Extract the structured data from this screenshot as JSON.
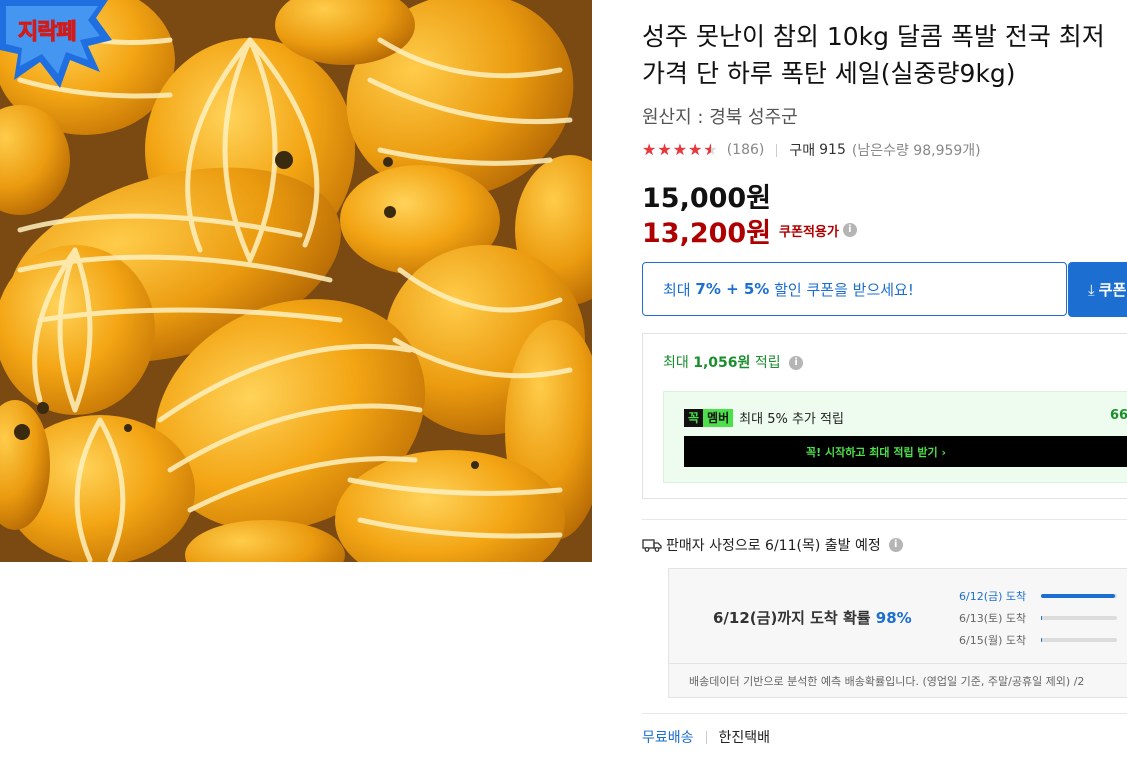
{
  "image": {
    "alt": "성주 참외",
    "badge_text": "지락페"
  },
  "product": {
    "title_line1": "성주 못난이 참외 10kg 달콤 폭발 전국 최저",
    "title_line2": "가격 단 하루 폭탄 세일(실중량9kg)",
    "origin_label": "원산지 :",
    "origin_value": "경북 성주군",
    "rating_fraction": 0.9,
    "review_count": "(186)",
    "purchase_label": "구매",
    "purchase_count": "915",
    "stock_text": "(남은수량 98,959개)"
  },
  "price": {
    "original": "15,000원",
    "sale": "13,200원",
    "coupon_note": "쿠폰적용가"
  },
  "coupon": {
    "prefix": "최대",
    "discount": "7% + 5%",
    "suffix": "할인 쿠폰을 받으세요!",
    "button_label": "쿠폰"
  },
  "reward": {
    "prefix": "최대",
    "amount": "1,056원",
    "suffix": "적립",
    "badge_dark": "꼭",
    "badge_green": "멤버",
    "member_text": "최대 5% 추가 적립",
    "member_amount": "66",
    "cta": "꼭! 시작하고 최대 적립 받기 ›"
  },
  "shipping": {
    "notice": "판매자 사정으로 6/11(목) 출발 예정",
    "arrival_prefix": "6/12(금)까지 도착 확률",
    "arrival_pct": "98%",
    "days": [
      {
        "date": "6/12(금) 도착",
        "fraction": 0.98
      },
      {
        "date": "6/13(토) 도착",
        "fraction": 0.01
      },
      {
        "date": "6/15(월) 도착",
        "fraction": 0.01
      }
    ],
    "footnote": "배송데이터 기반으로 분석한 예측 배송확률입니다. (영업일 기준, 주말/공휴일 제외) /2",
    "free_shipping": "무료배송",
    "carrier": "한진택배"
  },
  "colors": {
    "accent_blue": "#1c6fd1",
    "sale_red": "#ae0000",
    "reward_green": "#1b8e2e",
    "star_red": "#e8383d"
  }
}
